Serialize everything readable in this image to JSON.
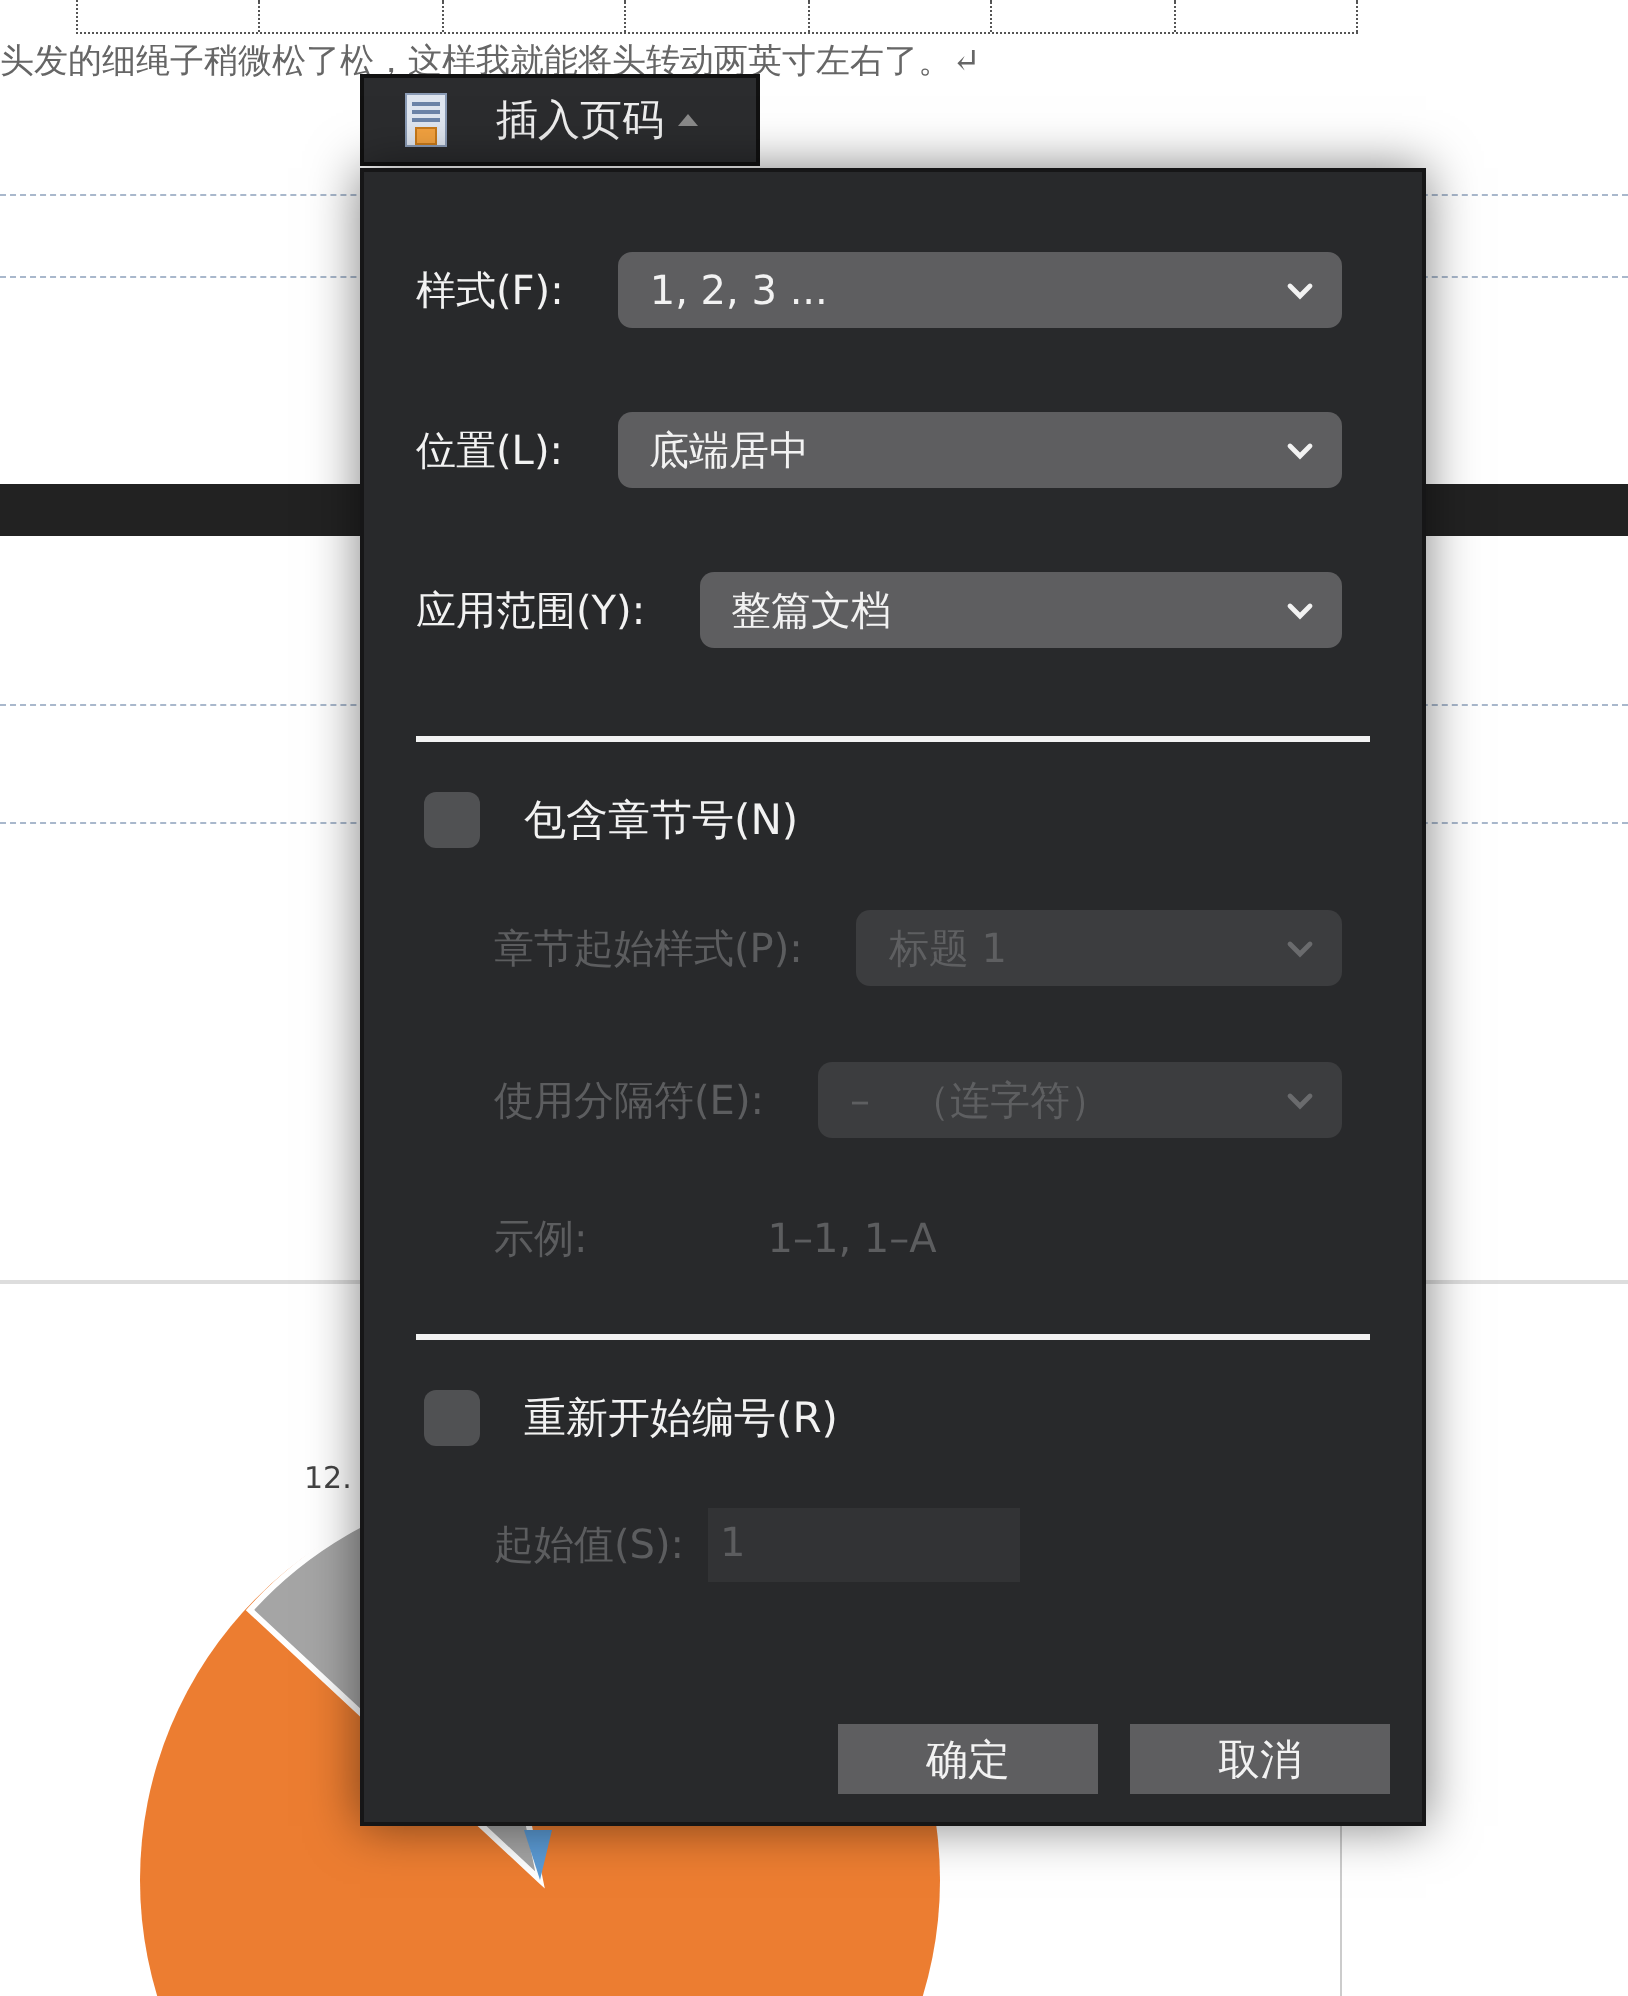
{
  "document": {
    "text_line": "头发的细绳子稍微松了松，这样我就能将头转动两英寸左右了。↵",
    "chart_label": "12."
  },
  "popup_button": {
    "label": "插入页码"
  },
  "dialog": {
    "rows": [
      {
        "kind": "select",
        "label": "样式(F):",
        "value": "1, 2, 3 ...",
        "disabled": false
      },
      {
        "kind": "select",
        "label": "位置(L):",
        "value": "底端居中",
        "disabled": false
      },
      {
        "kind": "select",
        "label": "应用范围(Y):",
        "value": "整篇文档",
        "disabled": false
      },
      {
        "kind": "divider"
      },
      {
        "kind": "checkbox",
        "label": "包含章节号(N)",
        "checked": false,
        "children": [
          {
            "kind": "select",
            "label": "章节起始样式(P):",
            "value": "标题 1",
            "disabled": true
          },
          {
            "kind": "select",
            "label": "使用分隔符(E):",
            "value": "–　（连字符）",
            "disabled": true
          },
          {
            "kind": "info",
            "label": "示例:",
            "value": "1–1, 1–A",
            "disabled": true
          }
        ]
      },
      {
        "kind": "divider"
      },
      {
        "kind": "checkbox",
        "label": "重新开始编号(R)",
        "checked": false,
        "children": [
          {
            "kind": "input",
            "label": "起始值(S):",
            "value": "1",
            "disabled": true
          }
        ]
      }
    ],
    "buttons": [
      "确定",
      "取消"
    ]
  }
}
